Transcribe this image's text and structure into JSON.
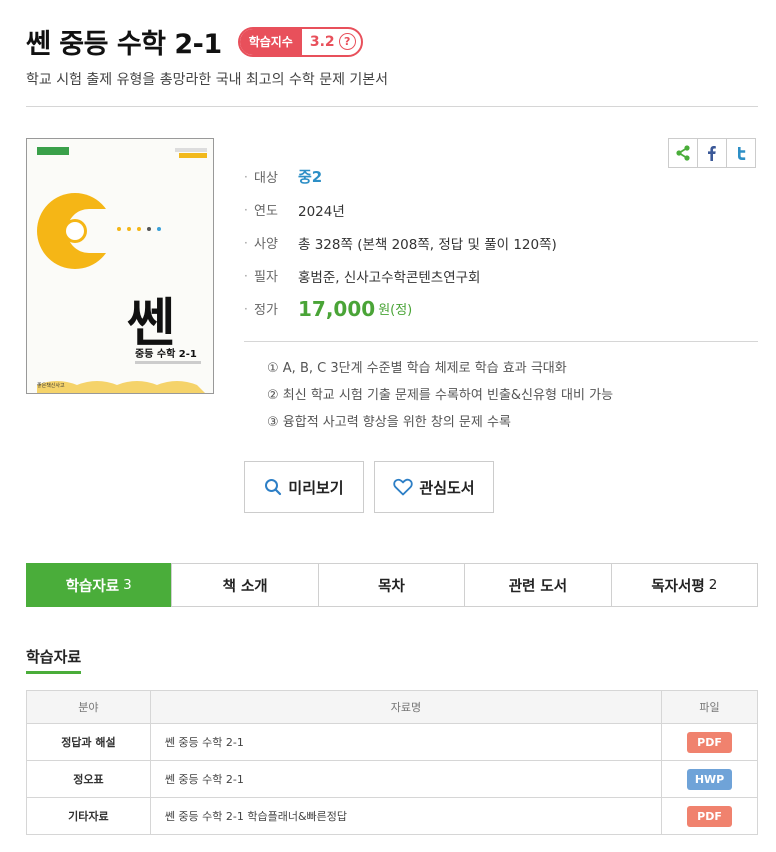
{
  "book": {
    "title": "쎈 중등 수학 2-1",
    "index_label": "학습지수",
    "index_value": "3.2",
    "help_glyph": "?",
    "subtitle": "학교 시험 출제 유형을 총망라한 국내 최고의 수학 문제 기본서"
  },
  "cover": {
    "logo_text": "좋은책신사고",
    "brand_text": "쎈",
    "book_title_text": "중등 수학 2-1"
  },
  "share": {
    "icons": [
      "share-icon",
      "facebook-icon",
      "twitter-icon"
    ]
  },
  "specs": [
    {
      "label": "대상",
      "value": "중2"
    },
    {
      "label": "연도",
      "value": "2024년"
    },
    {
      "label": "사양",
      "value": "총 328쪽 (본책 208쪽, 정답 및 풀이 120쪽)"
    },
    {
      "label": "필자",
      "value": "홍범준, 신사고수학콘텐츠연구회"
    },
    {
      "label": "정가",
      "value": "17,000",
      "unit": "원(정)"
    }
  ],
  "features": [
    "① A, B, C 3단계 수준별 학습 체제로 학습 효과 극대화",
    "② 최신 학교 시험 기출 문제를 수록하여 빈출&신유형 대비 가능",
    "③ 융합적 사고력 향상을 위한 창의 문제 수록"
  ],
  "actions": {
    "preview": "미리보기",
    "wishlist": "관심도서"
  },
  "tabs": [
    {
      "label": "학습자료",
      "count": "3"
    },
    {
      "label": "책 소개",
      "count": ""
    },
    {
      "label": "목차",
      "count": ""
    },
    {
      "label": "관련 도서",
      "count": ""
    },
    {
      "label": "독자서평",
      "count": "2"
    }
  ],
  "materials": {
    "section_title": "학습자료",
    "headers": [
      "분야",
      "자료명",
      "파일"
    ],
    "rows": [
      {
        "category": "정답과 해설",
        "name": "쎈 중등 수학 2-1",
        "file": "PDF"
      },
      {
        "category": "정오표",
        "name": "쎈 중등 수학 2-1",
        "file": "HWP"
      },
      {
        "category": "기타자료",
        "name": "쎈 중등 수학 2-1 학습플래너&빠른정답",
        "file": "PDF"
      }
    ]
  },
  "colors": {
    "accent_green": "#4aad3a",
    "badge_red": "#e8505b",
    "pdf": "#f0826e",
    "hwp": "#6fa3d8",
    "grade_blue": "#2d8fc6"
  }
}
